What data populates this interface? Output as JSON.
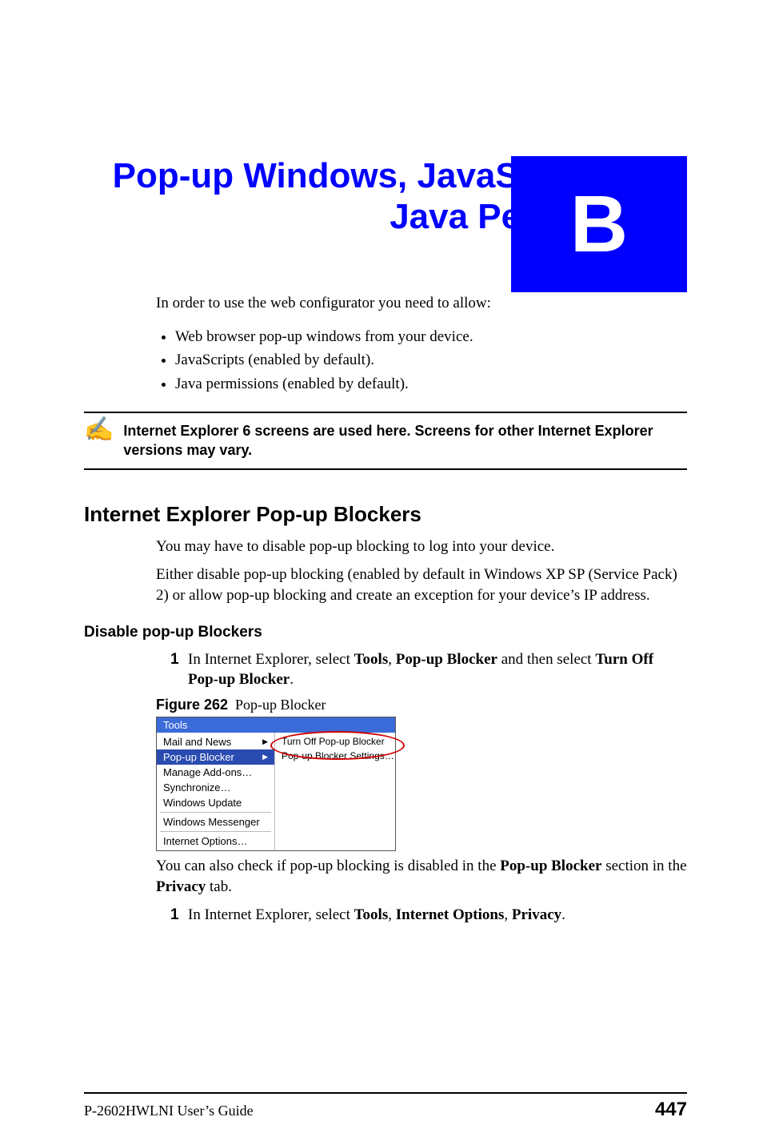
{
  "appendix_letter": "B",
  "title": "Pop-up Windows, JavaScripts and Java Permissions",
  "intro_line": "In order to use the web configurator you need to allow:",
  "bullets": [
    "Web browser pop-up windows from your device.",
    "JavaScripts (enabled by default).",
    "Java permissions (enabled by default)."
  ],
  "note_text": "Internet Explorer 6 screens are used here. Screens for other Internet Explorer versions may vary.",
  "section_heading": "Internet Explorer Pop-up Blockers",
  "section_p1": "You may have to disable pop-up blocking to log into your device.",
  "section_p2": "Either disable pop-up blocking (enabled by default in Windows XP SP (Service Pack) 2) or allow pop-up blocking and create an exception for your device’s IP address.",
  "subhead": "Disable pop-up Blockers",
  "step1_num": "1",
  "step1_pre": "In Internet Explorer, select ",
  "step1_b1": "Tools",
  "step1_sep1": ", ",
  "step1_b2": "Pop-up Blocker",
  "step1_mid": " and then select ",
  "step1_b3": "Turn Off Pop-up Blocker",
  "step1_end": ".",
  "fig_label": "Figure 262",
  "fig_caption": "Pop-up Blocker",
  "menu": {
    "header": "Tools",
    "items": [
      "Mail and News",
      "Pop-up Blocker",
      "Manage Add-ons…",
      "Synchronize…",
      "Windows Update",
      "Windows Messenger",
      "Internet Options…"
    ],
    "submenu": [
      "Turn Off Pop-up Blocker",
      "Pop-up Blocker Settings…"
    ]
  },
  "after_fig_pre": "You can also check if pop-up blocking is disabled in the ",
  "after_fig_b1": "Pop-up Blocker",
  "after_fig_mid": " section in the ",
  "after_fig_b2": "Privacy",
  "after_fig_end": " tab.",
  "step2_num": "1",
  "step2_pre": "In Internet Explorer, select ",
  "step2_b1": "Tools",
  "step2_sep1": ", ",
  "step2_b2": "Internet Options",
  "step2_sep2": ", ",
  "step2_b3": "Privacy",
  "step2_end": ".",
  "footer_guide": "P-2602HWLNI User’s Guide",
  "footer_page": "447"
}
